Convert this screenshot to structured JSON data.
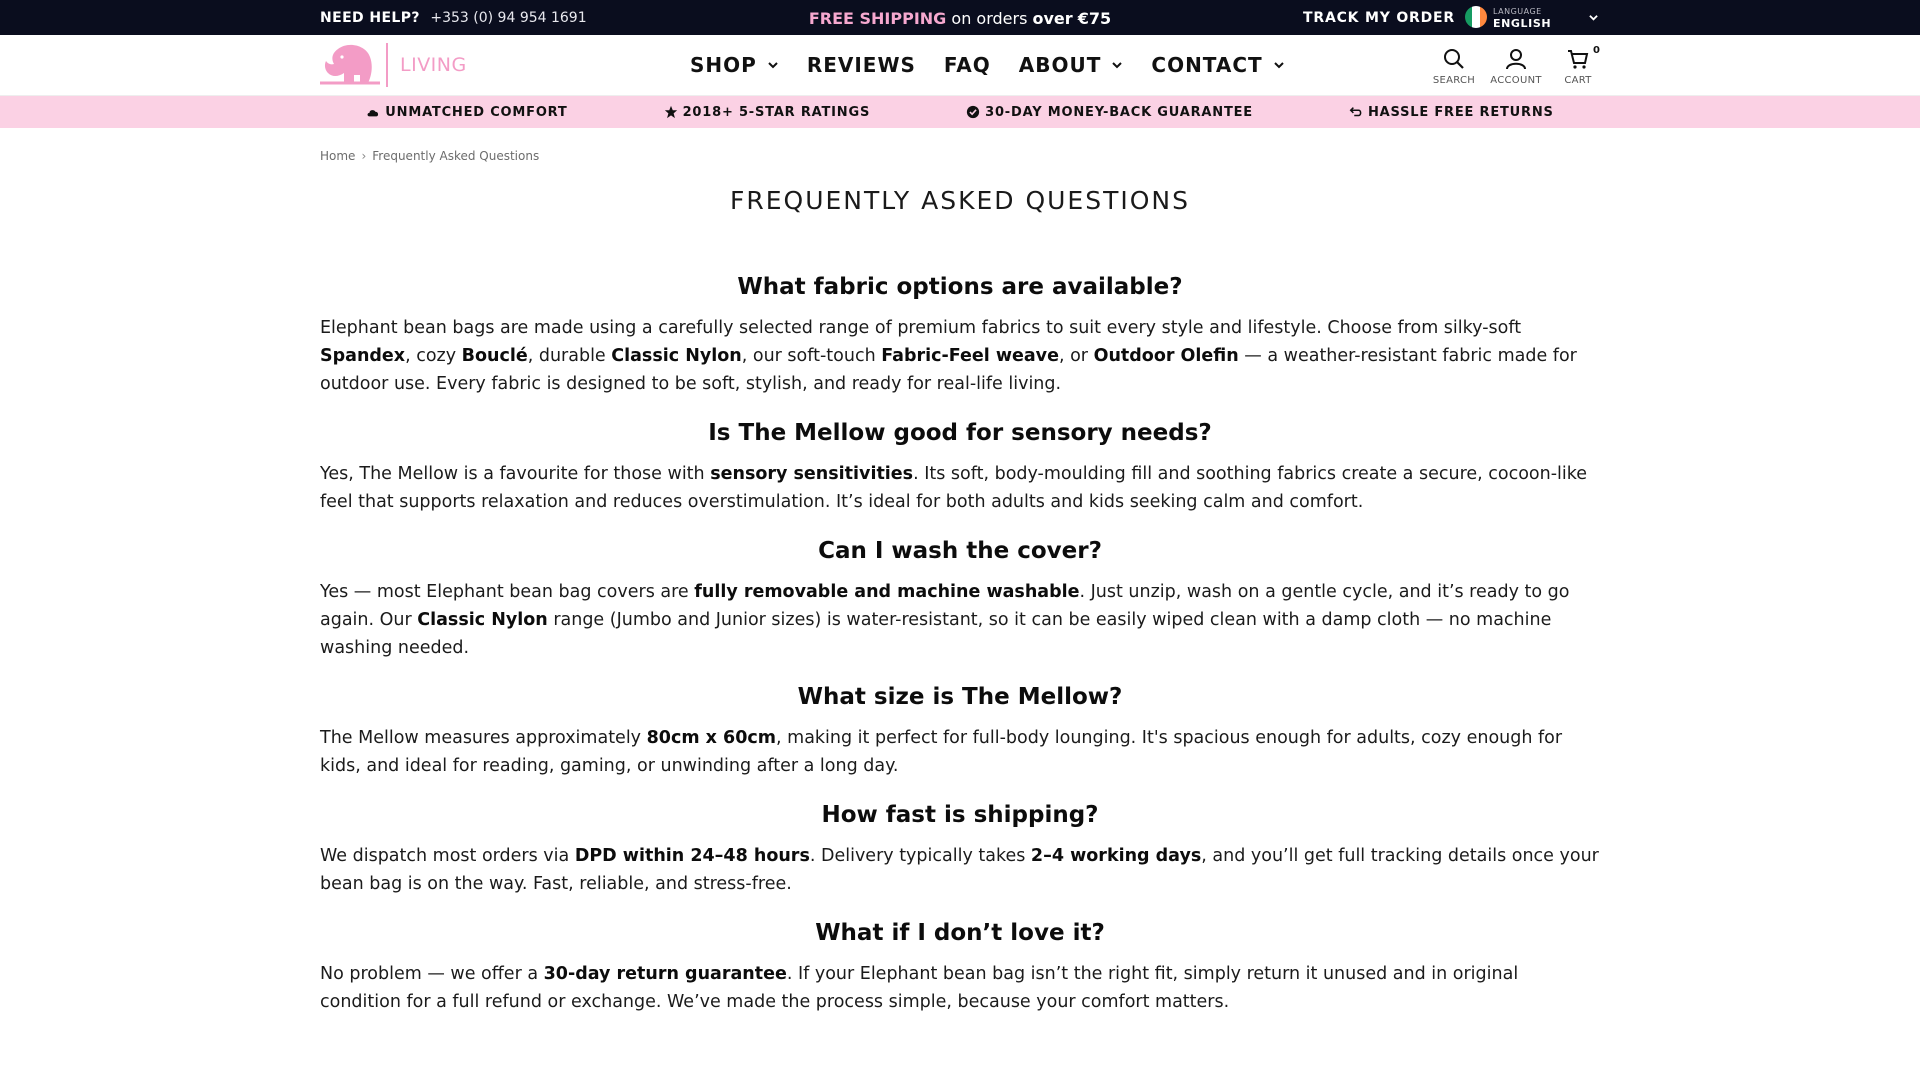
{
  "topbar": {
    "help_label": "NEED HELP?",
    "phone": "+353 (0) 94 954 1691",
    "promo_free": "FREE SHIPPING",
    "promo_mid": " on orders ",
    "promo_over": "over",
    "promo_amount": "€75",
    "track_label": "TRACK MY ORDER",
    "language_caption": "LANGUAGE",
    "language_value": "ENGLISH",
    "flag_colors": [
      "#169b62",
      "#ffffff",
      "#ff883e"
    ]
  },
  "header": {
    "logo_text": "LIVING",
    "brand_color": "#f39cc6",
    "nav": [
      {
        "label": "SHOP",
        "dropdown": true
      },
      {
        "label": "REVIEWS",
        "dropdown": false
      },
      {
        "label": "FAQ",
        "dropdown": false
      },
      {
        "label": "ABOUT",
        "dropdown": true
      },
      {
        "label": "CONTACT",
        "dropdown": true
      }
    ],
    "icons": {
      "search": "SEARCH",
      "account": "ACCOUNT",
      "cart": "CART",
      "cart_count": "0"
    }
  },
  "trust": [
    {
      "icon": "cloud-icon",
      "label": "UNMATCHED COMFORT"
    },
    {
      "icon": "star-icon",
      "label": "2018+ 5-STAR RATINGS"
    },
    {
      "icon": "check-badge-icon",
      "label": "30-DAY MONEY-BACK GUARANTEE"
    },
    {
      "icon": "return-arrow-icon",
      "label": "HASSLE FREE RETURNS"
    }
  ],
  "breadcrumb": {
    "home": "Home",
    "current": "Frequently Asked Questions"
  },
  "page_title": "FREQUENTLY ASKED QUESTIONS",
  "faq": [
    {
      "question": "What fabric options are available?",
      "answer": [
        {
          "t": "Elephant bean bags are made using a carefully selected range of premium fabrics to suit every style and lifestyle. Choose from silky-soft "
        },
        {
          "t": "Spandex",
          "b": true
        },
        {
          "t": ", cozy "
        },
        {
          "t": "Bouclé",
          "b": true
        },
        {
          "t": ", durable "
        },
        {
          "t": "Classic Nylon",
          "b": true
        },
        {
          "t": ", our soft-touch "
        },
        {
          "t": "Fabric-Feel weave",
          "b": true
        },
        {
          "t": ", or "
        },
        {
          "t": "Outdoor Olefin",
          "b": true
        },
        {
          "t": " — a weather-resistant fabric made for outdoor use. Every fabric is designed to be soft, stylish, and ready for real-life living."
        }
      ]
    },
    {
      "question": "Is The Mellow good for sensory needs?",
      "answer": [
        {
          "t": "Yes, The Mellow is a favourite for those with "
        },
        {
          "t": "sensory sensitivities",
          "b": true
        },
        {
          "t": ". Its soft, body-moulding fill and soothing fabrics create a secure, cocoon-like feel that supports relaxation and reduces overstimulation. It’s ideal for both adults and kids seeking calm and comfort."
        }
      ]
    },
    {
      "question": "Can I wash the cover?",
      "answer": [
        {
          "t": "Yes — most Elephant bean bag covers are "
        },
        {
          "t": "fully removable and machine washable",
          "b": true
        },
        {
          "t": ". Just unzip, wash on a gentle cycle, and it’s ready to go again. Our "
        },
        {
          "t": "Classic Nylon",
          "b": true
        },
        {
          "t": " range (Jumbo and Junior sizes) is water-resistant, so it can be easily wiped clean with a damp cloth — no machine washing needed."
        }
      ]
    },
    {
      "question": "What size is The Mellow?",
      "answer": [
        {
          "t": "The Mellow measures approximately "
        },
        {
          "t": "80cm x 60cm",
          "b": true
        },
        {
          "t": ", making it perfect for full-body lounging. It's spacious enough for adults, cozy enough for kids, and ideal for reading, gaming, or unwinding after a long day."
        }
      ]
    },
    {
      "question": "How fast is shipping?",
      "answer": [
        {
          "t": "We dispatch most orders via "
        },
        {
          "t": "DPD within 24–48 hours",
          "b": true
        },
        {
          "t": ". Delivery typically takes "
        },
        {
          "t": "2–4 working days",
          "b": true
        },
        {
          "t": ", and you’ll get full tracking details once your bean bag is on the way. Fast, reliable, and stress-free."
        }
      ]
    },
    {
      "question": "What if I don’t love it?",
      "answer": [
        {
          "t": "No problem — we offer a "
        },
        {
          "t": "30-day return guarantee",
          "b": true
        },
        {
          "t": ". If your Elephant bean bag isn’t the right fit, simply return it unused and in original condition for a full refund or exchange. We’ve made the process simple, because your comfort matters."
        }
      ]
    }
  ]
}
